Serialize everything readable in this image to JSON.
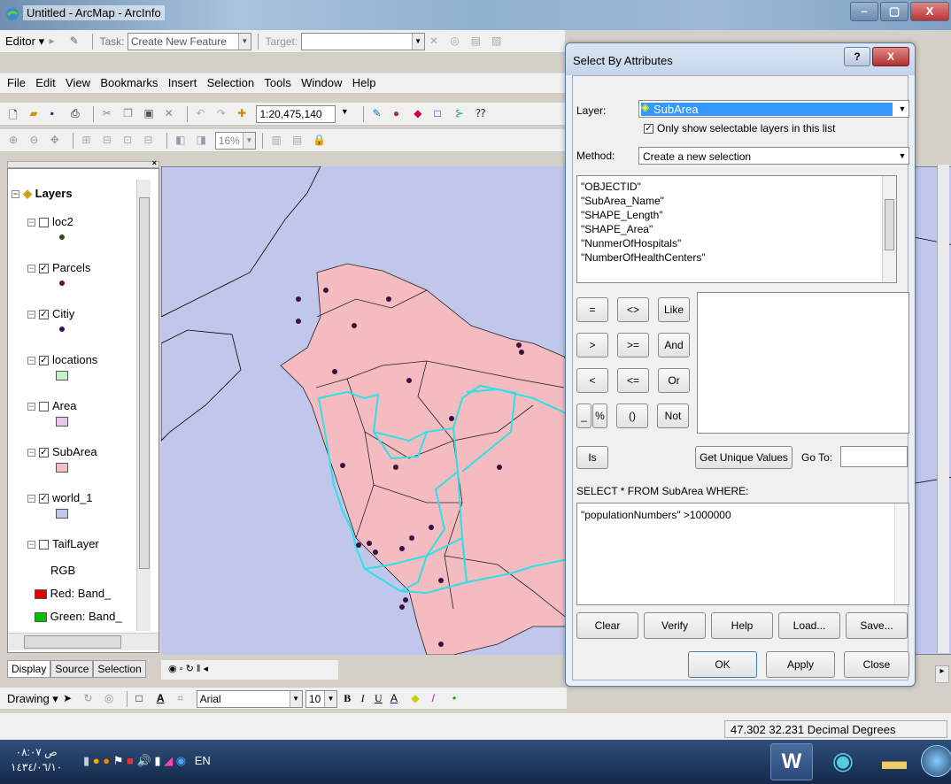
{
  "window": {
    "title": "Untitled - ArcMap - ArcInfo",
    "minimize": "–",
    "maximize": "▢",
    "close": "X"
  },
  "editor_toolbar": {
    "editor_label": "Editor ▾",
    "task_label": "Task:",
    "task_value": "Create New Feature",
    "target_label": "Target:",
    "target_value": ""
  },
  "menu": {
    "items": [
      "File",
      "Edit",
      "View",
      "Bookmarks",
      "Insert",
      "Selection",
      "Tools",
      "Window",
      "Help"
    ]
  },
  "standard_toolbar": {
    "scale": "1:20,475,140"
  },
  "tools_toolbar": {
    "zoom": "16%"
  },
  "toc": {
    "root": "Layers",
    "layers": [
      {
        "name": "loc2",
        "checked": false,
        "symbol": "point",
        "color": "#2a4a1a"
      },
      {
        "name": "Parcels",
        "checked": true,
        "symbol": "point",
        "color": "#5a1040"
      },
      {
        "name": "Citiy",
        "checked": true,
        "symbol": "point",
        "color": "#3a1060"
      },
      {
        "name": "locations",
        "checked": true,
        "symbol": "fill",
        "color": "#c8f0c8"
      },
      {
        "name": "Area",
        "checked": false,
        "symbol": "fill",
        "color": "#e8c8e8"
      },
      {
        "name": "SubArea",
        "checked": true,
        "symbol": "fill",
        "color": "#f4c0c8"
      },
      {
        "name": "world_1",
        "checked": true,
        "symbol": "fill",
        "color": "#c0c8ea"
      },
      {
        "name": "TaifLayer",
        "checked": false,
        "symbol": "none",
        "color": ""
      }
    ],
    "raster_label": "RGB",
    "bands": [
      {
        "label": "Red:  Band_",
        "color": "#e00000"
      },
      {
        "label": "Green: Band_",
        "color": "#00c000"
      }
    ],
    "tabs": [
      "Display",
      "Source",
      "Selection"
    ]
  },
  "dialog": {
    "title": "Select By Attributes",
    "help_btn": "?",
    "close_btn": "X",
    "layer_label": "Layer:",
    "layer_value": "SubArea",
    "only_selectable_label": "Only show selectable layers in this list",
    "method_label": "Method:",
    "method_value": "Create a new selection",
    "fields": [
      "\"OBJECTID\"",
      "\"SubArea_Name\"",
      "\"SHAPE_Length\"",
      "\"SHAPE_Area\"",
      "\"NunmerOfHospitals\"",
      "\"NumberOfHealthCenters\""
    ],
    "operators": [
      [
        "=",
        "<>",
        "Like"
      ],
      [
        ">",
        ">=",
        "And"
      ],
      [
        "<",
        "<=",
        "Or"
      ],
      [
        "_",
        "%",
        "()",
        "Not"
      ]
    ],
    "is_btn": "Is",
    "get_unique_btn": "Get Unique Values",
    "goto_label": "Go To:",
    "sql_label": "SELECT * FROM SubArea WHERE:",
    "sql_text": "\"populationNumbers\" >1000000",
    "buttons": [
      "Clear",
      "Verify",
      "Help",
      "Load...",
      "Save..."
    ],
    "ok": "OK",
    "apply": "Apply",
    "close": "Close"
  },
  "drawing_toolbar": {
    "drawing_label": "Drawing ▾",
    "font": "Arial",
    "size": "10",
    "bold": "B",
    "italic": "I",
    "underline": "U"
  },
  "status": {
    "coords": "47.302  32.231 Decimal Degrees"
  },
  "taskbar": {
    "time": "ص ٠٨:٠٧",
    "date": "١٤٣٤/٠٦/١٠",
    "lang": "EN"
  }
}
